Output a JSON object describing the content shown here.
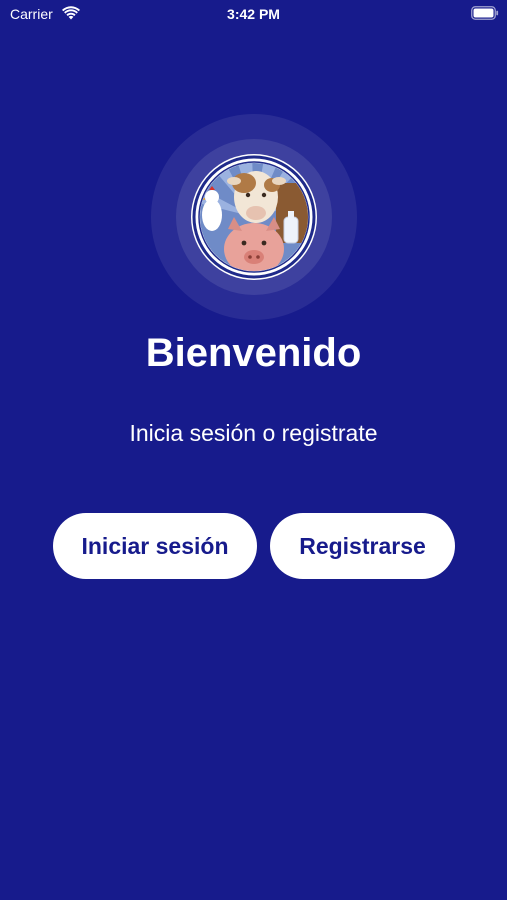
{
  "status_bar": {
    "carrier": "Carrier",
    "time": "3:42 PM",
    "wifi_icon": "wifi-icon",
    "battery_icon": "battery-icon"
  },
  "logo": {
    "icon": "farm-animals-logo"
  },
  "welcome": {
    "title": "Bienvenido",
    "subtitle": "Inicia sesión o registrate"
  },
  "actions": {
    "login_label": "Iniciar sesión",
    "register_label": "Registrarse"
  },
  "colors": {
    "background": "#171b8c",
    "button_background": "#ffffff",
    "button_text": "#171b8c",
    "text": "#ffffff"
  }
}
